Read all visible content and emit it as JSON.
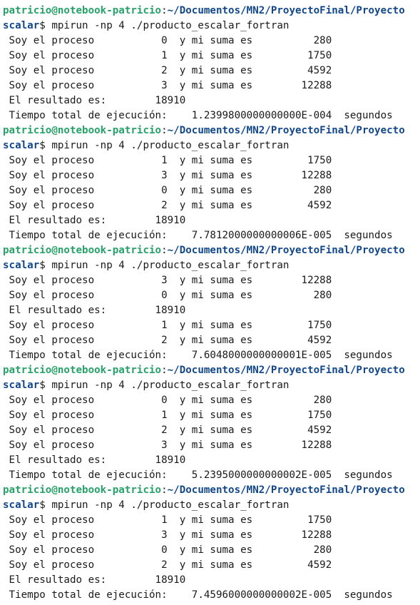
{
  "colors": {
    "background": "#ffffff",
    "text": "#1a1a1a",
    "user_host": "#26a269",
    "path": "#12488b"
  },
  "prompt": {
    "user_host": "patricio@notebook-patricio",
    "colon": ":",
    "path": "~/Documentos/MN2/ProyectoFinal/Proyecto",
    "path_continued": "scalar",
    "dollar": "$",
    "command": " mpirun -np 4 ./producto_escalar_fortran"
  },
  "runs": [
    {
      "output": [
        " Soy el proceso           0  y mi suma es          280",
        " Soy el proceso           1  y mi suma es         1750",
        " Soy el proceso           2  y mi suma es         4592",
        " Soy el proceso           3  y mi suma es        12288",
        " El resultado es:        18910",
        " Tiempo total de ejecución:    1.2399800000000000E-004  segundos"
      ]
    },
    {
      "output": [
        " Soy el proceso           1  y mi suma es         1750",
        " Soy el proceso           3  y mi suma es        12288",
        " Soy el proceso           0  y mi suma es          280",
        " Soy el proceso           2  y mi suma es         4592",
        " El resultado es:        18910",
        " Tiempo total de ejecución:    7.7812000000000006E-005  segundos"
      ]
    },
    {
      "output": [
        " Soy el proceso           3  y mi suma es        12288",
        " Soy el proceso           0  y mi suma es          280",
        " El resultado es:        18910",
        " Soy el proceso           1  y mi suma es         1750",
        " Soy el proceso           2  y mi suma es         4592",
        " Tiempo total de ejecución:    7.6048000000000001E-005  segundos"
      ]
    },
    {
      "output": [
        " Soy el proceso           0  y mi suma es          280",
        " Soy el proceso           1  y mi suma es         1750",
        " Soy el proceso           2  y mi suma es         4592",
        " Soy el proceso           3  y mi suma es        12288",
        " El resultado es:        18910",
        " Tiempo total de ejecución:    5.2395000000000002E-005  segundos"
      ]
    },
    {
      "output": [
        " Soy el proceso           1  y mi suma es         1750",
        " Soy el proceso           3  y mi suma es        12288",
        " Soy el proceso           0  y mi suma es          280",
        " Soy el proceso           2  y mi suma es         4592",
        " El resultado es:        18910",
        " Tiempo total de ejecución:    7.4596000000000002E-005  segundos"
      ]
    }
  ]
}
